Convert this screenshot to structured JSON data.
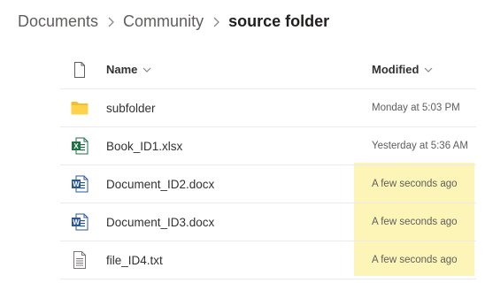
{
  "breadcrumb": {
    "items": [
      "Documents",
      "Community"
    ],
    "current": "source folder"
  },
  "columns": {
    "name_label": "Name",
    "modified_label": "Modified"
  },
  "highlight_color": "#fdf5b8",
  "files": [
    {
      "name": "subfolder",
      "modified": "Monday at 5:03 PM",
      "icon": "folder-icon"
    },
    {
      "name": "Book_ID1.xlsx",
      "modified": "Yesterday at 5:36 AM",
      "icon": "excel-file-icon"
    },
    {
      "name": "Document_ID2.docx",
      "modified": "A few seconds ago",
      "icon": "word-file-icon"
    },
    {
      "name": "Document_ID3.docx",
      "modified": "A few seconds ago",
      "icon": "word-file-icon"
    },
    {
      "name": "file_ID4.txt",
      "modified": "A few seconds ago",
      "icon": "text-file-icon"
    }
  ]
}
